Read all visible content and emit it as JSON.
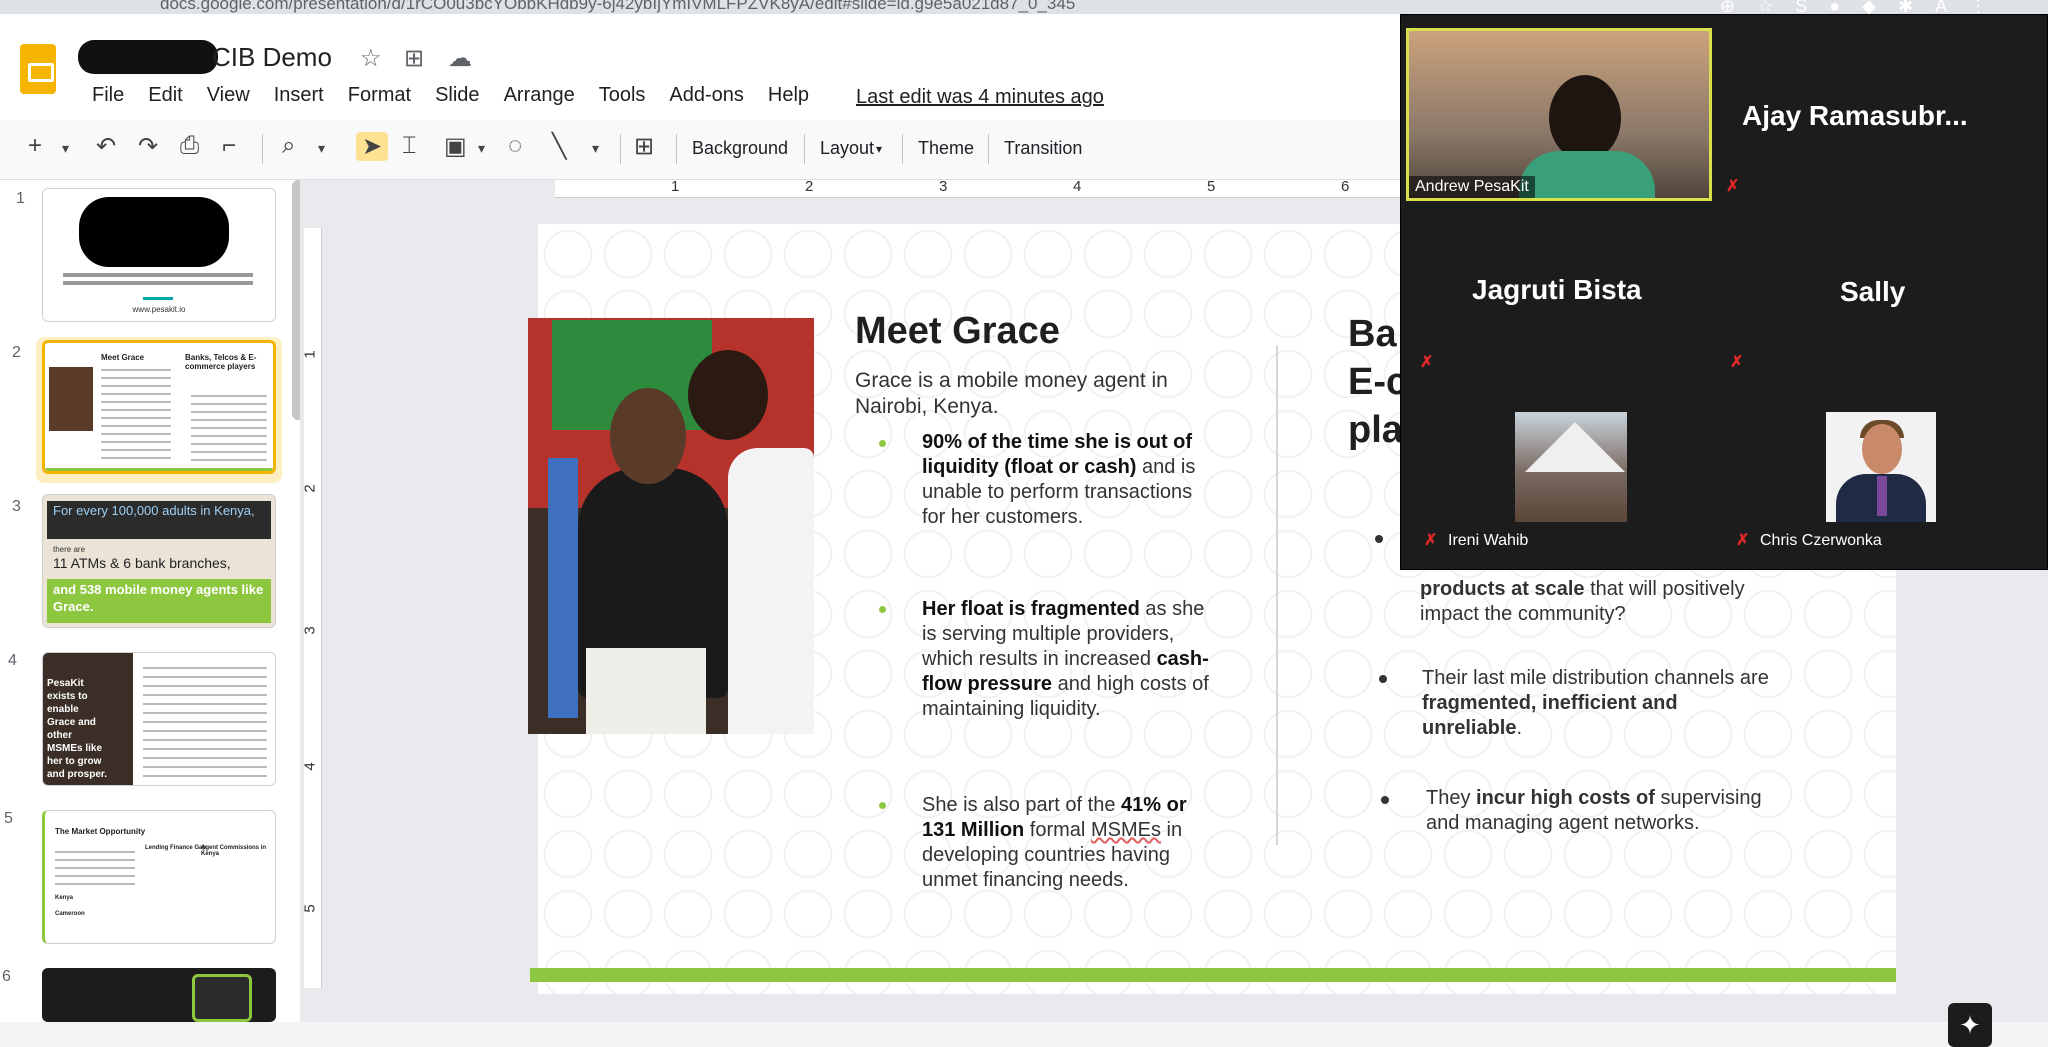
{
  "browser": {
    "url": "docs.google.com/presentation/d/1rCO0u3bcYObbKHdb9y-6j42ybIjYmIVMLFPZVK8yA/edit#slide=id.g9e5a021d87_0_345"
  },
  "app": {
    "title": "CIB Demo",
    "last_edit": "Last edit was 4 minutes ago",
    "menu": [
      "File",
      "Edit",
      "View",
      "Insert",
      "Format",
      "Slide",
      "Arrange",
      "Tools",
      "Add-ons",
      "Help"
    ]
  },
  "toolbar": {
    "background": "Background",
    "layout": "Layout",
    "theme": "Theme",
    "transition": "Transition"
  },
  "filmstrip": {
    "numbers": [
      "1",
      "2",
      "3",
      "4",
      "5",
      "6"
    ],
    "slide1": {
      "url": "www.pesakit.io"
    },
    "slide2": {
      "title_left": "Meet Grace",
      "title_right": "Banks, Telcos & E-commerce players"
    },
    "slide3": {
      "line1": "For every 100,000 adults in Kenya,",
      "line2": "there are",
      "line3": "11 ATMs & 6 bank branches,",
      "line4": "and 538 mobile money agents like Grace."
    },
    "slide4": {
      "text": "PesaKit exists to enable Grace and other MSMEs like her to grow and prosper."
    },
    "slide5": {
      "title": "The Market Opportunity",
      "col2": "Lending Finance Gap",
      "col3": "Agent Commissions in Kenya",
      "kenya": "Kenya",
      "cameroon": "Cameroon"
    }
  },
  "ruler": {
    "h": [
      "1",
      "2",
      "3",
      "4",
      "5",
      "6"
    ],
    "v": [
      "1",
      "2",
      "3",
      "4",
      "5"
    ]
  },
  "slide": {
    "title": "Meet Grace",
    "subtitle": "Grace is a mobile money agent in Nairobi, Kenya.",
    "b1_bold": "90% of the time she is out of liquidity (float or cash)",
    "b1_rest": " and is unable to perform transactions for her customers.",
    "b2_bold1": "Her float is fragmented",
    "b2_mid": " as she is serving multiple providers, which results in increased ",
    "b2_bold2": "cash-flow pressure",
    "b2_end": " and high costs of maintaining liquidity.",
    "b3_start": "She is also part of the ",
    "b3_bold": "41% or 131 Million",
    "b3_mid": " formal ",
    "b3_underline": "MSMEs",
    "b3_end": " in developing countries having unmet financing needs.",
    "right_title_l1": "Ba",
    "right_title_l2": "E-c",
    "right_title_l3": "pla",
    "r1_bold": "products at scale",
    "r1_rest": " that will positively impact the community?",
    "r2_start": "Their last mile distribution channels are ",
    "r2_bold": "fragmented, inefficient and unreliable",
    "r2_end": ".",
    "r3_start": "They ",
    "r3_bold": "incur high costs of",
    "r3_end": " supervising and managing agent networks."
  },
  "zoom": {
    "andrew": "Andrew PesaKit",
    "ajay": "Ajay  Ramasubr...",
    "jagruti": "Jagruti Bista",
    "sally": "Sally",
    "ireni": "Ireni Wahib",
    "chris": "Chris Czerwonka"
  },
  "colors": {
    "accent": "#f4b400",
    "brand_green": "#8dc63f",
    "zoom_bg": "#1c1c1c",
    "active_speaker": "#d9e04b",
    "mute": "#e02828"
  }
}
